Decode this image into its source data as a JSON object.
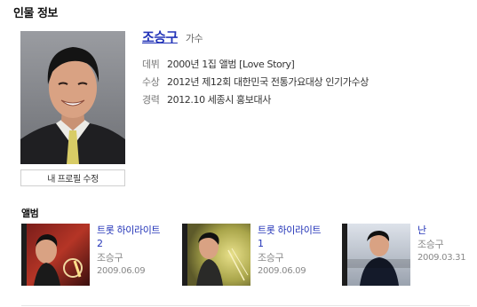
{
  "section": {
    "title": "인물 정보"
  },
  "profile": {
    "name": "조승구",
    "role": "가수",
    "edit_label": "내 프로필 수정",
    "info": [
      {
        "label": "데뷔",
        "value": "2000년 1집 앨범 [Love Story]"
      },
      {
        "label": "수상",
        "value": "2012년 제12회 대한민국 전통가요대상 인기가수상"
      },
      {
        "label": "경력",
        "value": "2012.10 세종시 홍보대사"
      }
    ]
  },
  "albums": {
    "heading": "앨범",
    "items": [
      {
        "title": "트롯 하이라이트 2",
        "artist": "조승구",
        "date": "2009.06.09",
        "cover_icon": "album-cover-image"
      },
      {
        "title": "트롯 하이라이트 1",
        "artist": "조승구",
        "date": "2009.06.09",
        "cover_icon": "album-cover-image"
      },
      {
        "title": "난",
        "artist": "조승구",
        "date": "2009.03.31",
        "cover_icon": "album-cover-image"
      }
    ]
  },
  "colors": {
    "link": "#2435b8",
    "muted": "#888888",
    "label": "#777777"
  }
}
